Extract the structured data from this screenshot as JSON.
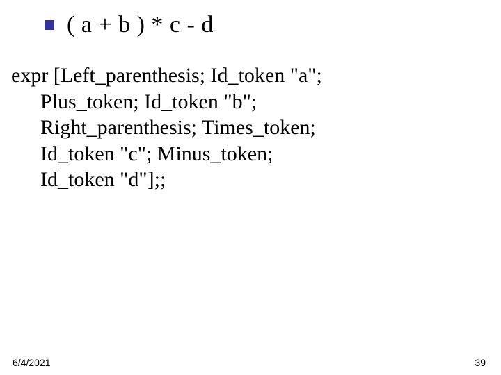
{
  "title": "( a + b ) * c - d",
  "body": {
    "line1": "expr [Left_parenthesis; Id_token \"a\";",
    "line2": "Plus_token; Id_token \"b\";",
    "line3": "Right_parenthesis; Times_token;",
    "line4": "Id_token \"c\"; Minus_token;",
    "line5": "Id_token \"d\"];;"
  },
  "footer": {
    "date": "6/4/2021",
    "page": "39"
  }
}
